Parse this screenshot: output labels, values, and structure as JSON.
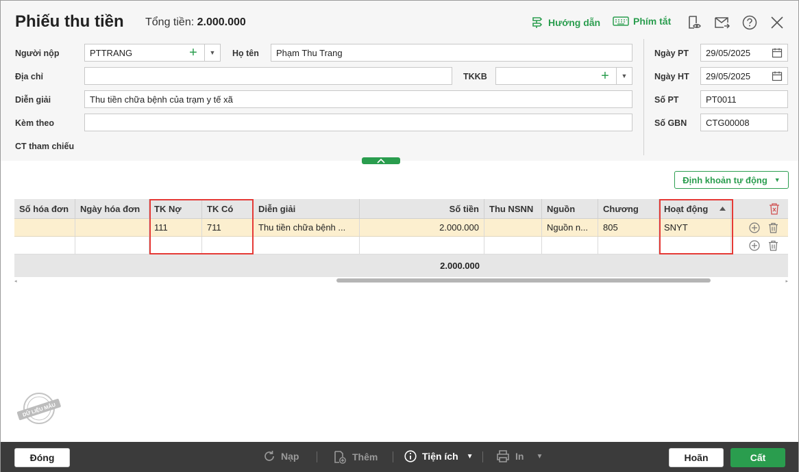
{
  "header": {
    "title": "Phiếu thu tiền",
    "total_label": "Tổng tiền:",
    "total_value": "2.000.000",
    "guide_label": "Hướng dẫn",
    "shortcut_label": "Phím tắt"
  },
  "form": {
    "payer_label": "Người nộp",
    "payer_value": "PTTRANG",
    "fullname_label": "Họ tên",
    "fullname_value": "Phạm Thu Trang",
    "address_label": "Địa chỉ",
    "address_value": "",
    "tkkb_label": "TKKB",
    "tkkb_value": "",
    "description_label": "Diễn giải",
    "description_value": "Thu tiền chữa bệnh của trạm y tế xã",
    "attach_label": "Kèm theo",
    "attach_value": "",
    "ref_label": "CT tham chiếu",
    "date_pt_label": "Ngày PT",
    "date_pt_value": "29/05/2025",
    "date_ht_label": "Ngày HT",
    "date_ht_value": "29/05/2025",
    "so_pt_label": "Số PT",
    "so_pt_value": "PT0011",
    "so_gbn_label": "Số GBN",
    "so_gbn_value": "CTG00008"
  },
  "auto_button": "Định khoản tự động",
  "grid": {
    "columns": [
      "Số hóa đơn",
      "Ngày hóa đơn",
      "TK Nợ",
      "TK Có",
      "Diễn giải",
      "Số tiền",
      "Thu NSNN",
      "Nguồn",
      "Chương",
      "Hoạt động"
    ],
    "rows": [
      {
        "so_hd": "",
        "ngay_hd": "",
        "tk_no": "111",
        "tk_co": "711",
        "dien_giai": "Thu tiền chữa bệnh ...",
        "so_tien": "2.000.000",
        "thu_nsnn": "",
        "nguon": "Nguồn n...",
        "chuong": "805",
        "hoat_dong": "SNYT"
      },
      {
        "so_hd": "",
        "ngay_hd": "",
        "tk_no": "",
        "tk_co": "",
        "dien_giai": "",
        "so_tien": "",
        "thu_nsnn": "",
        "nguon": "",
        "chuong": "",
        "hoat_dong": ""
      }
    ],
    "total": "2.000.000"
  },
  "watermark": "DỮ LIỆU MẪU",
  "footer": {
    "close": "Đóng",
    "reload": "Nạp",
    "add": "Thêm",
    "utility": "Tiện ích",
    "print": "In",
    "cancel": "Hoãn",
    "save": "Cất"
  },
  "colors": {
    "accent": "#2a9d4e",
    "highlight_row": "#fcefcf",
    "annotation": "#e53935",
    "footer_bg": "#3b3b3b"
  }
}
